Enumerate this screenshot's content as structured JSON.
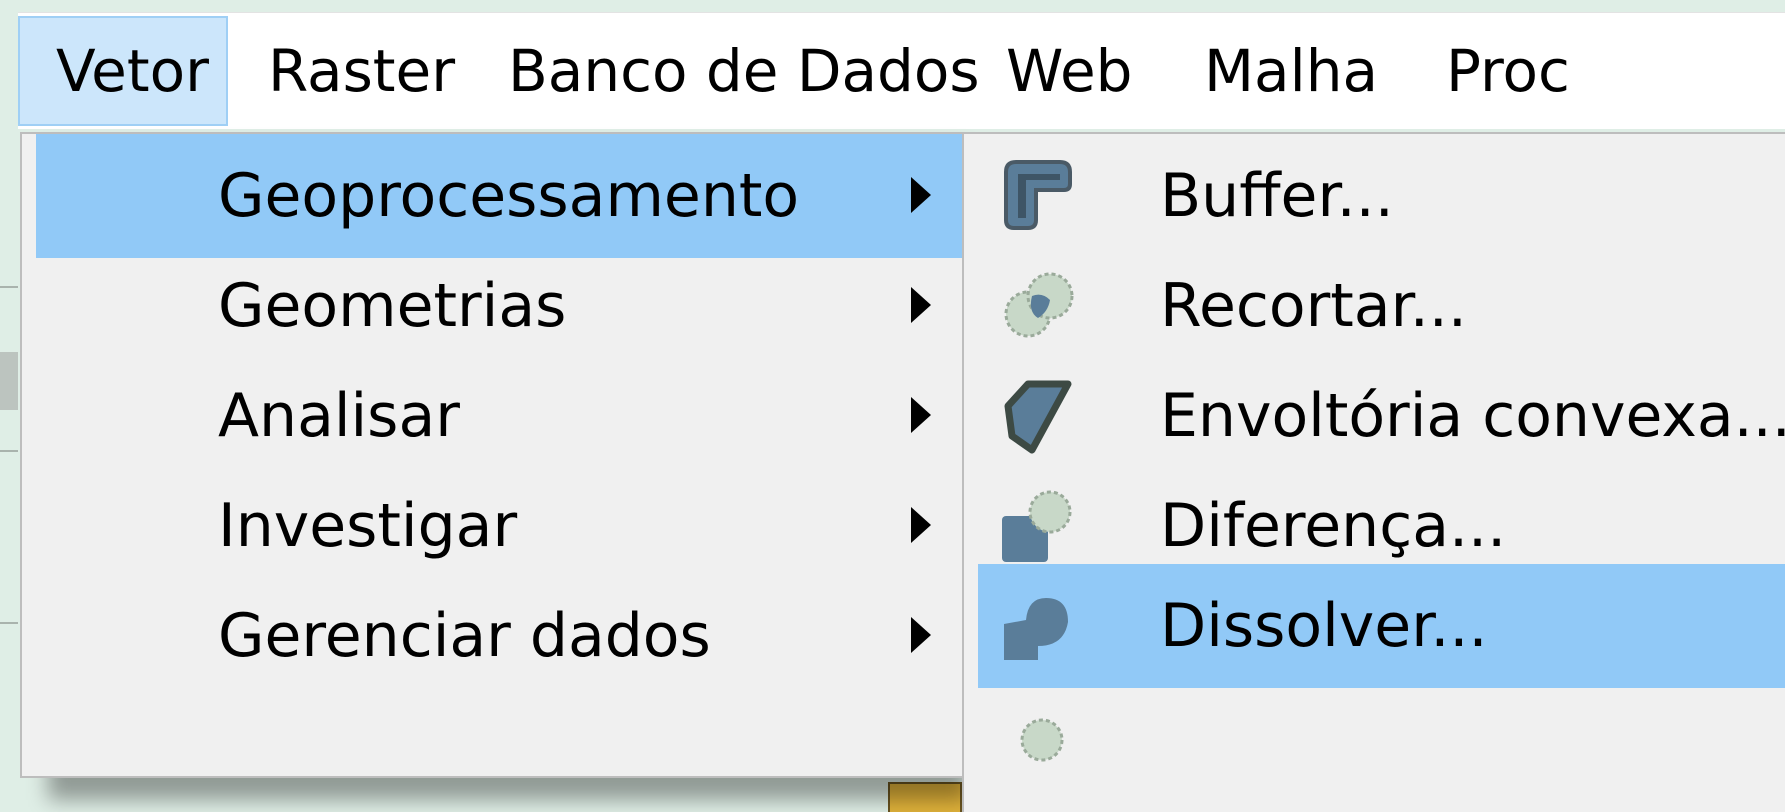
{
  "menubar": {
    "items": [
      {
        "label": "Vetor",
        "active": true
      },
      {
        "label": "Raster"
      },
      {
        "label": "Banco de Dados"
      },
      {
        "label": "Web"
      },
      {
        "label": "Malha"
      },
      {
        "label": "Proc"
      }
    ]
  },
  "vector_menu": {
    "items": [
      {
        "label": "Geoprocessamento",
        "highlighted": true,
        "has_submenu": true
      },
      {
        "label": "Geometrias",
        "has_submenu": true
      },
      {
        "label": "Analisar",
        "has_submenu": true
      },
      {
        "label": "Investigar",
        "has_submenu": true
      },
      {
        "label": "Gerenciar dados",
        "has_submenu": true
      }
    ]
  },
  "geoprocessing_submenu": {
    "items": [
      {
        "label": "Buffer...",
        "icon": "buffer-icon"
      },
      {
        "label": "Recortar...",
        "icon": "clip-icon"
      },
      {
        "label": "Envoltória convexa...",
        "icon": "convex-hull-icon"
      },
      {
        "label": "Diferença...",
        "icon": "difference-icon"
      },
      {
        "label": "Dissolver...",
        "icon": "dissolve-icon",
        "highlighted": true
      },
      {
        "label": "",
        "icon": "intersection-icon"
      }
    ]
  },
  "colors": {
    "menu_highlight": "#91c9f7",
    "menubar_active": "#cce6fb",
    "menu_bg": "#f0f0f0",
    "icon_fill": "#5a7d99"
  }
}
